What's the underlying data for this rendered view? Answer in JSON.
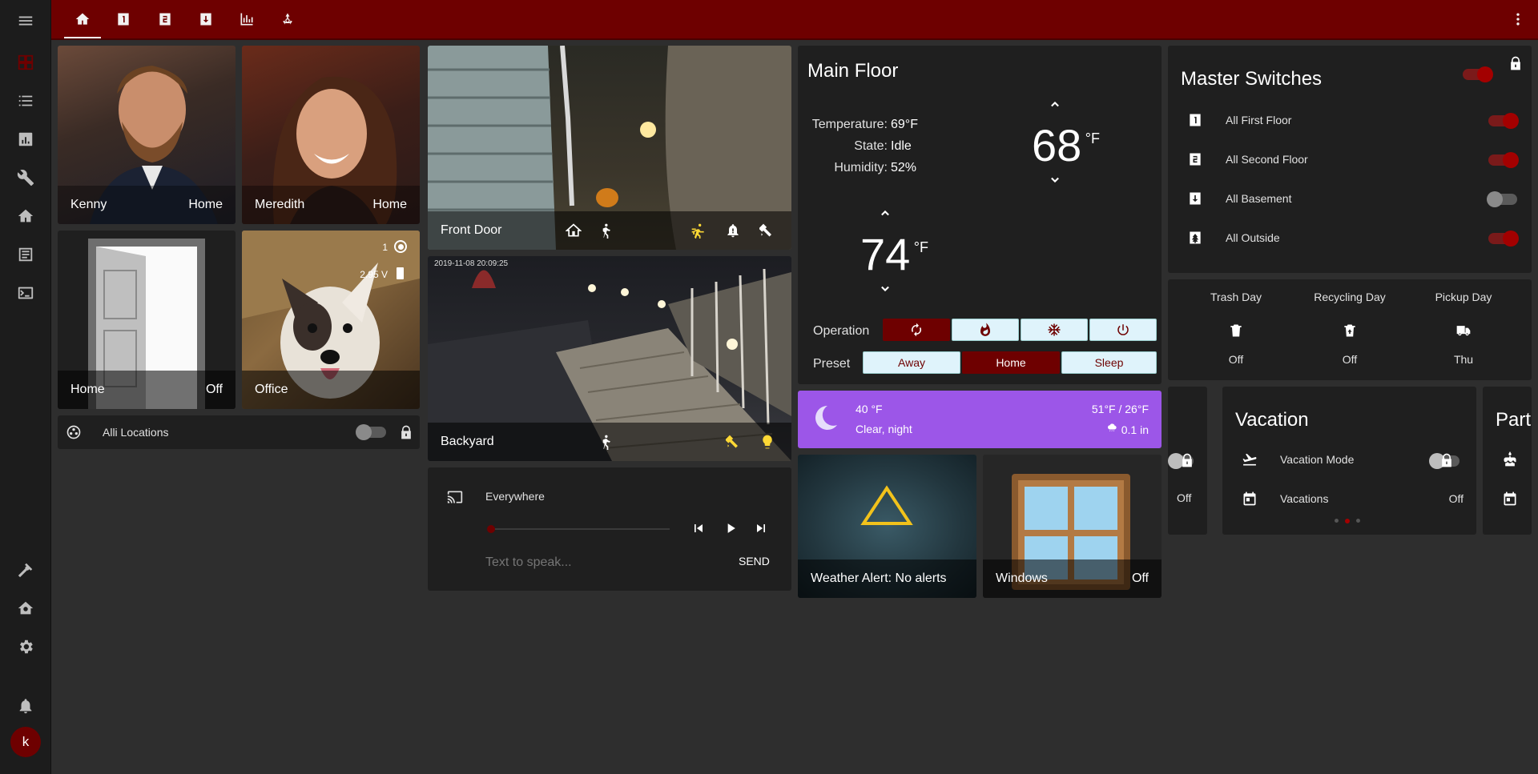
{
  "colors": {
    "accent": "#6e0000",
    "sidebar": "#1c1c1c",
    "card": "#1f1f1f",
    "weather": "#9c56e8",
    "toggle_on": "#a30000"
  },
  "sidebar": {
    "menu_icon": "menu-icon",
    "items": [
      "lovelace-icon",
      "logbook-icon",
      "history-icon",
      "config-icon",
      "home-icon",
      "list-icon",
      "terminal-icon"
    ],
    "bottom": [
      "hammer-icon",
      "home-gear-icon",
      "settings-icon",
      "bell-icon"
    ],
    "avatar_letter": "k"
  },
  "tabs": [
    "home-icon",
    "floor-1-icon",
    "floor-2-icon",
    "basement-icon",
    "chart-icon",
    "recycle-icon"
  ],
  "people": [
    {
      "name": "Kenny",
      "state": "Home"
    },
    {
      "name": "Meredith",
      "state": "Home"
    }
  ],
  "door": {
    "name": "Home",
    "state": "Off"
  },
  "office": {
    "name": "Office",
    "count": "1",
    "battery": "2.95 V"
  },
  "locations": {
    "label": "Alli Locations"
  },
  "cameras": {
    "front": {
      "name": "Front Door"
    },
    "backyard": {
      "name": "Backyard",
      "timestamp": "2019-11-08 20:09:25"
    }
  },
  "media": {
    "title": "Everywhere",
    "tts_placeholder": "Text to speak...",
    "send": "SEND"
  },
  "thermostat": {
    "title": "Main Floor",
    "temperature_label": "Temperature:",
    "temperature": "69°F",
    "state_label": "State:",
    "state": "Idle",
    "humidity_label": "Humidity:",
    "humidity": "52%",
    "high": "68",
    "low": "74",
    "unit": "°F",
    "operation_label": "Operation",
    "preset_label": "Preset",
    "presets": [
      "Away",
      "Home",
      "Sleep"
    ]
  },
  "weather": {
    "temp": "40 °F",
    "condition": "Clear, night",
    "hilo": "51°F / 26°F",
    "precip": "0.1 in"
  },
  "weather_alert": {
    "label": "Weather Alert: No alerts"
  },
  "windows": {
    "name": "Windows",
    "state": "Off"
  },
  "master": {
    "title": "Master Switches",
    "items": [
      {
        "label": "All First Floor",
        "on": true
      },
      {
        "label": "All Second Floor",
        "on": true
      },
      {
        "label": "All Basement",
        "on": false
      },
      {
        "label": "All Outside",
        "on": true
      }
    ]
  },
  "days": [
    {
      "label": "Trash Day",
      "state": "Off"
    },
    {
      "label": "Recycling Day",
      "state": "Off"
    },
    {
      "label": "Pickup Day",
      "state": "Thu"
    }
  ],
  "partial_left": {
    "state": "Off"
  },
  "vacation": {
    "title": "Vacation",
    "mode_label": "Vacation Mode",
    "vacations_label": "Vacations",
    "vacations_state": "Off"
  },
  "partial_right": {
    "title": "Part"
  }
}
